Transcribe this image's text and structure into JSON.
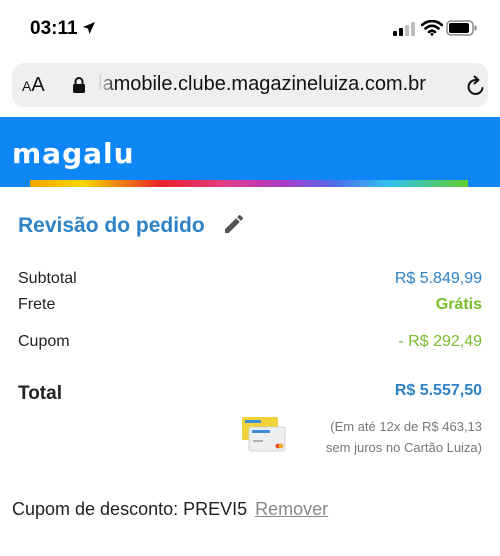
{
  "status_bar": {
    "time": "03:11"
  },
  "address_bar": {
    "aa_label_small": "A",
    "aa_label_large": "A",
    "url": "lamobile.clube.magazineluiza.com.br"
  },
  "header": {
    "logo": "magalu"
  },
  "order_review": {
    "title": "Revisão do pedido",
    "subtotal_label": "Subtotal",
    "subtotal_value": "R$ 5.849,99",
    "shipping_label": "Frete",
    "shipping_value": "Grátis",
    "coupon_label": "Cupom",
    "coupon_value": "-  R$ 292,49",
    "total_label": "Total",
    "total_value": "R$ 5.557,50",
    "installment_line1": "(Em até 12x de R$ 463,13",
    "installment_line2": "sem juros no Cartão Luiza)"
  },
  "coupon": {
    "label": "Cupom de desconto: PREVI5",
    "remove_label": "Remover"
  },
  "colors": {
    "header_blue": "#0f86f5",
    "title_blue": "#2e82c6",
    "free_green": "#78be2d"
  }
}
